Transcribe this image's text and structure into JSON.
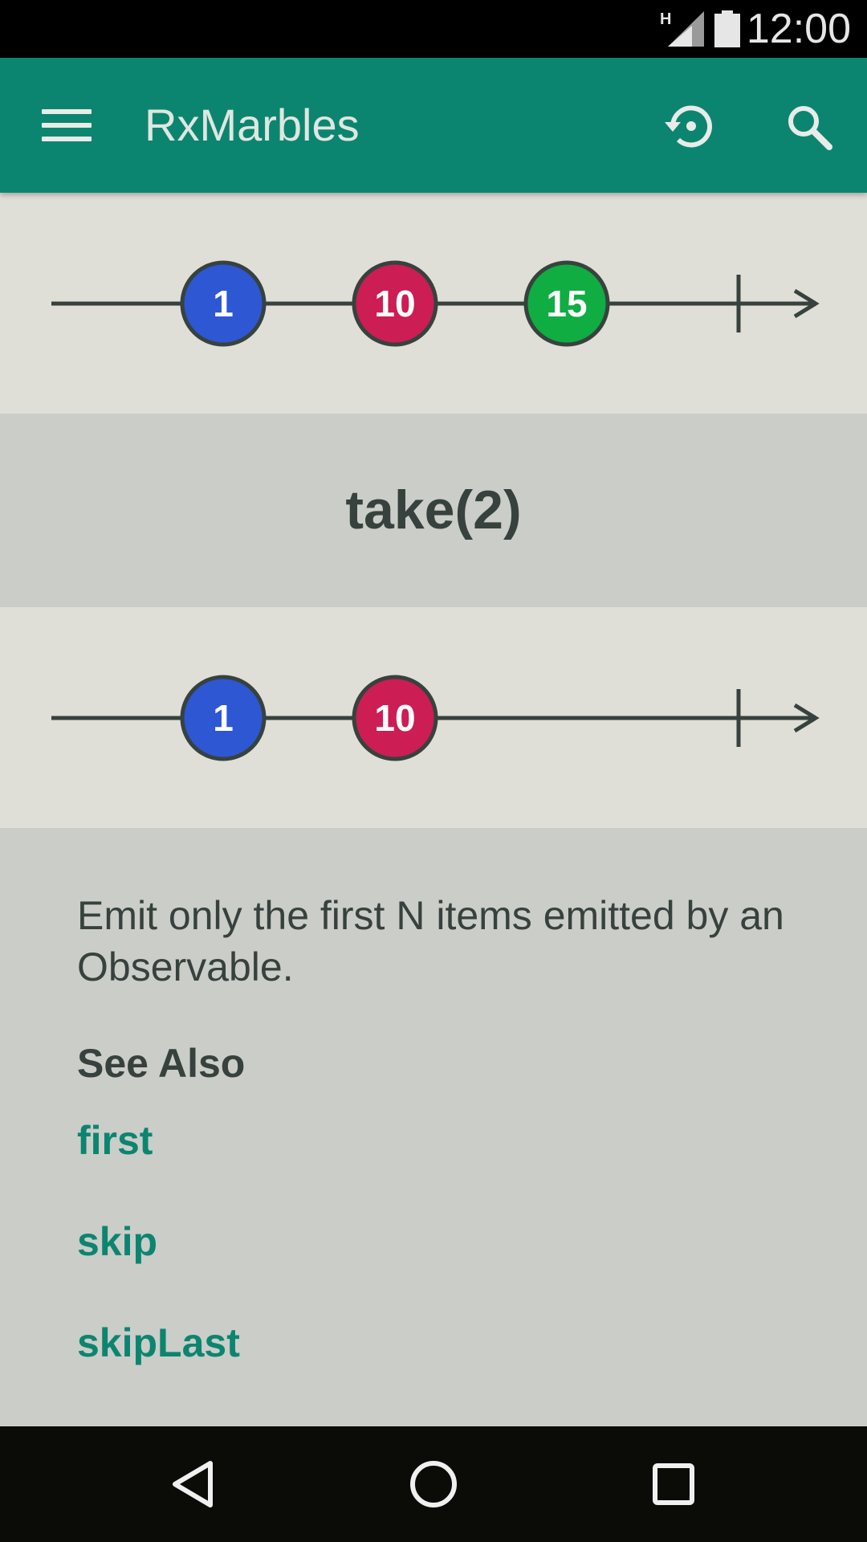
{
  "status_bar": {
    "time": "12:00",
    "network_label": "H",
    "signal_icon": "cell-signal-icon",
    "battery_icon": "battery-icon"
  },
  "app_bar": {
    "title": "RxMarbles",
    "menu_icon": "hamburger-menu-icon",
    "actions": [
      {
        "icon": "history-icon"
      },
      {
        "icon": "search-icon"
      }
    ]
  },
  "diagram": {
    "input_marbles": [
      {
        "label": "1",
        "color": "#2d57d3"
      },
      {
        "label": "10",
        "color": "#cc1d55"
      },
      {
        "label": "15",
        "color": "#0fad42"
      }
    ],
    "operator": "take(2)",
    "output_marbles": [
      {
        "label": "1",
        "color": "#2d57d3"
      },
      {
        "label": "10",
        "color": "#cc1d55"
      }
    ],
    "line_color": "#37423e"
  },
  "description": "Emit only the first N items emitted by an Observable.",
  "see_also": {
    "heading": "See Also",
    "links": [
      "first",
      "skip",
      "skipLast"
    ]
  },
  "nav_bar": {
    "buttons": [
      {
        "icon": "back-triangle-icon"
      },
      {
        "icon": "home-circle-icon"
      },
      {
        "icon": "recents-square-icon"
      }
    ]
  },
  "colors": {
    "primary": "#0c8570",
    "marble_row_background": "#dfdfd7",
    "page_background": "#cbcdc8",
    "text": "#37423e"
  }
}
